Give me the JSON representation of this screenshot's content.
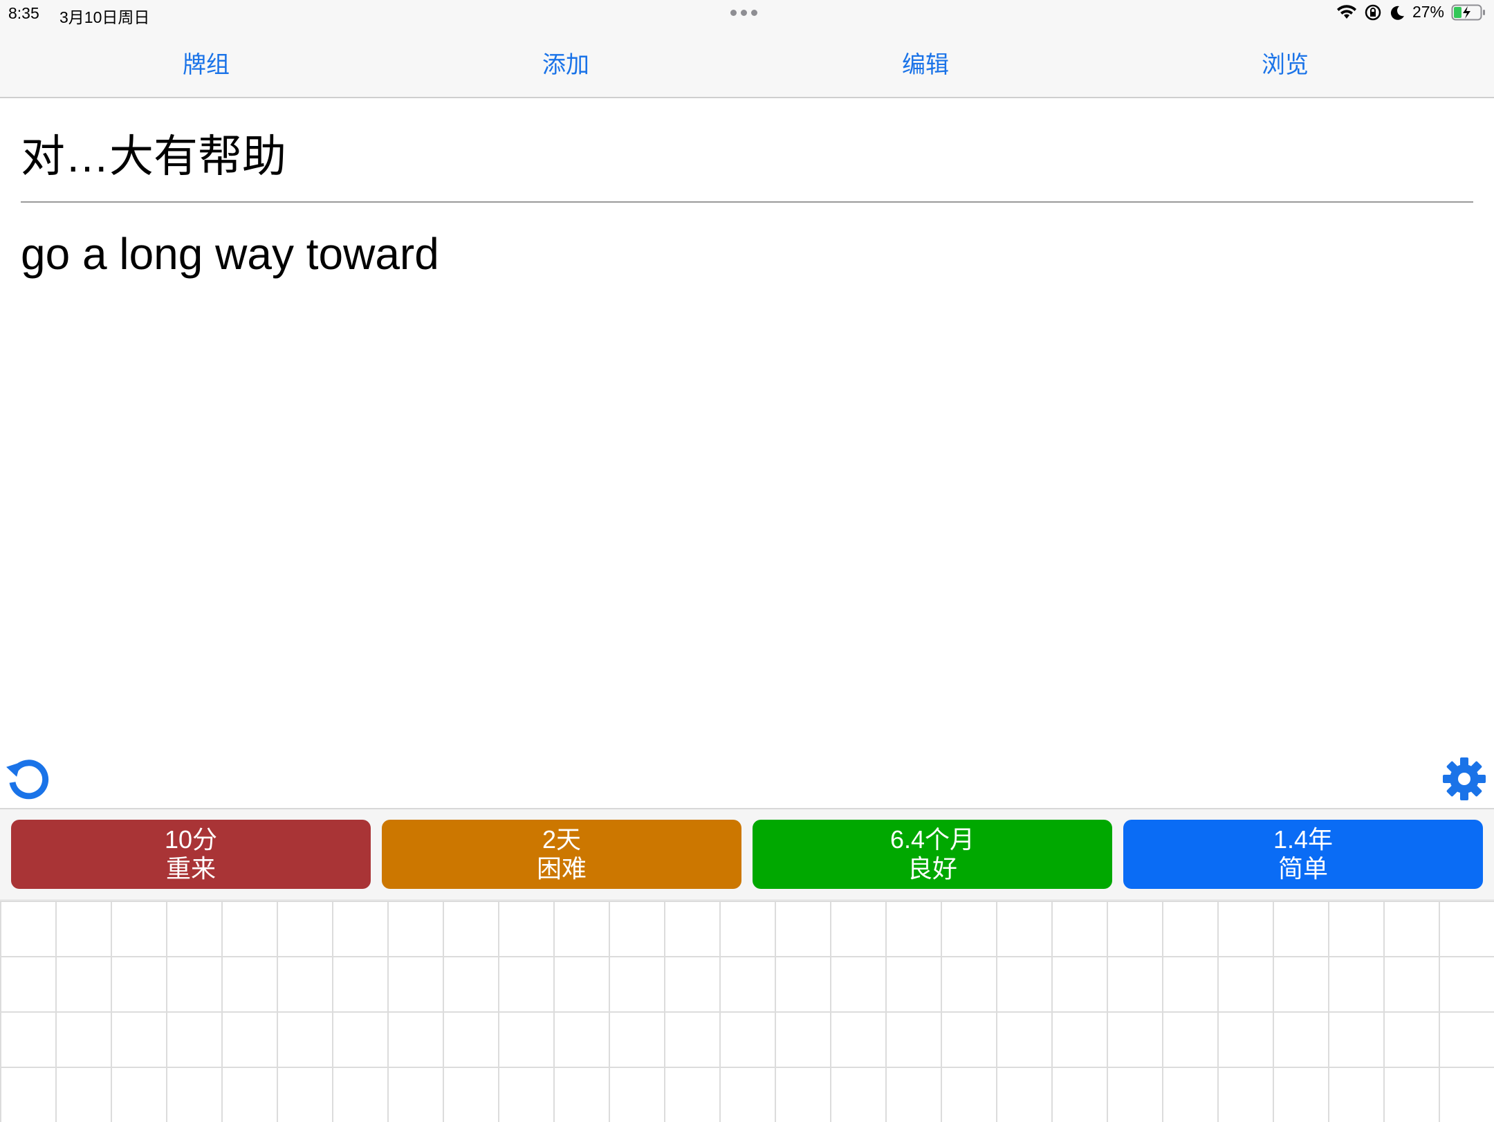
{
  "status": {
    "time": "8:35",
    "date": "3月10日周日",
    "battery": "27%",
    "icons": [
      "wifi-icon",
      "orientation-lock-icon",
      "moon-icon",
      "battery-charging-icon"
    ]
  },
  "nav": {
    "items": [
      {
        "label": "牌组"
      },
      {
        "label": "添加"
      },
      {
        "label": "编辑"
      },
      {
        "label": "浏览"
      }
    ],
    "color": "#1a73e8"
  },
  "card": {
    "front": "对…大有帮助",
    "back": "go a long way toward"
  },
  "controls": {
    "undo_icon": "undo-icon",
    "settings_icon": "gear-icon",
    "accent": "#1a73e8"
  },
  "answers": [
    {
      "interval": "10分",
      "label": "重来",
      "color": "#a93436"
    },
    {
      "interval": "2天",
      "label": "困难",
      "color": "#cc7700"
    },
    {
      "interval": "6.4个月",
      "label": "良好",
      "color": "#00a800"
    },
    {
      "interval": "1.4年",
      "label": "简单",
      "color": "#0a6cf5"
    }
  ]
}
